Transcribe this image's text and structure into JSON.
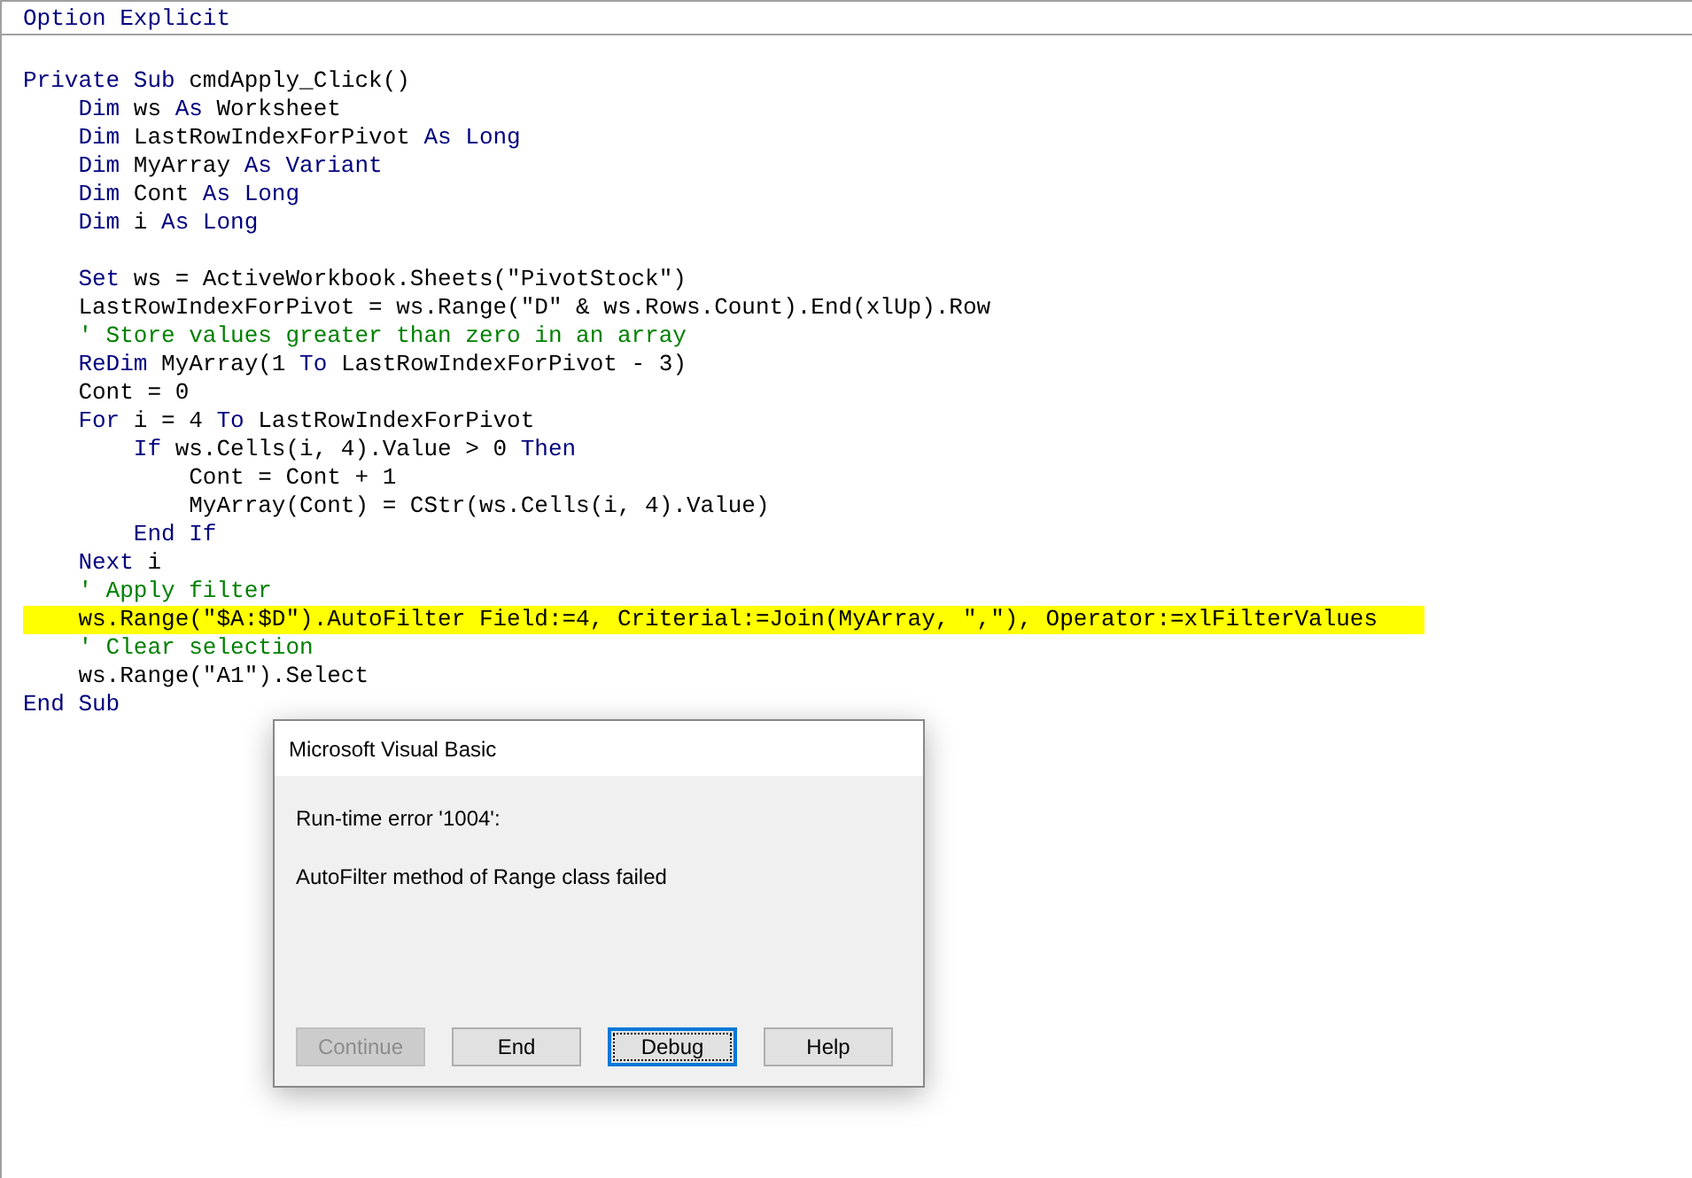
{
  "editor": {
    "declarations": [
      {
        "tokens": [
          {
            "kind": "keyword",
            "text": "Option Explicit"
          }
        ]
      }
    ],
    "lines": [
      {
        "highlighted": false
      },
      {
        "highlighted": false,
        "tokens": [
          {
            "kind": "keyword",
            "text": "Private Sub"
          },
          {
            "kind": "plain",
            "text": " cmdApply_Click()"
          }
        ]
      },
      {
        "highlighted": false,
        "tokens": [
          {
            "kind": "keyword",
            "text": "    Dim"
          },
          {
            "kind": "plain",
            "text": " ws "
          },
          {
            "kind": "keyword",
            "text": "As"
          },
          {
            "kind": "plain",
            "text": " Worksheet"
          }
        ]
      },
      {
        "highlighted": false,
        "tokens": [
          {
            "kind": "keyword",
            "text": "    Dim"
          },
          {
            "kind": "plain",
            "text": " LastRowIndexForPivot "
          },
          {
            "kind": "keyword",
            "text": "As Long"
          }
        ]
      },
      {
        "highlighted": false,
        "tokens": [
          {
            "kind": "keyword",
            "text": "    Dim"
          },
          {
            "kind": "plain",
            "text": " MyArray "
          },
          {
            "kind": "keyword",
            "text": "As Variant"
          }
        ]
      },
      {
        "highlighted": false,
        "tokens": [
          {
            "kind": "keyword",
            "text": "    Dim"
          },
          {
            "kind": "plain",
            "text": " Cont "
          },
          {
            "kind": "keyword",
            "text": "As Long"
          }
        ]
      },
      {
        "highlighted": false,
        "tokens": [
          {
            "kind": "keyword",
            "text": "    Dim"
          },
          {
            "kind": "plain",
            "text": " i "
          },
          {
            "kind": "keyword",
            "text": "As Long"
          }
        ]
      },
      {
        "highlighted": false
      },
      {
        "highlighted": false,
        "tokens": [
          {
            "kind": "keyword",
            "text": "    Set"
          },
          {
            "kind": "plain",
            "text": " ws = ActiveWorkbook.Sheets(\"PivotStock\")"
          }
        ]
      },
      {
        "highlighted": false,
        "tokens": [
          {
            "kind": "plain",
            "text": "    LastRowIndexForPivot = ws.Range(\"D\" & ws.Rows.Count).End(xlUp).Row"
          }
        ]
      },
      {
        "highlighted": false,
        "tokens": [
          {
            "kind": "comment",
            "text": "    ' Store values greater than zero in an array"
          }
        ]
      },
      {
        "highlighted": false,
        "tokens": [
          {
            "kind": "keyword",
            "text": "    ReDim"
          },
          {
            "kind": "plain",
            "text": " MyArray(1 "
          },
          {
            "kind": "keyword",
            "text": "To"
          },
          {
            "kind": "plain",
            "text": " LastRowIndexForPivot - 3)"
          }
        ]
      },
      {
        "highlighted": false,
        "tokens": [
          {
            "kind": "plain",
            "text": "    Cont = 0"
          }
        ]
      },
      {
        "highlighted": false,
        "tokens": [
          {
            "kind": "keyword",
            "text": "    For"
          },
          {
            "kind": "plain",
            "text": " i = 4 "
          },
          {
            "kind": "keyword",
            "text": "To"
          },
          {
            "kind": "plain",
            "text": " LastRowIndexForPivot"
          }
        ]
      },
      {
        "highlighted": false,
        "tokens": [
          {
            "kind": "keyword",
            "text": "        If"
          },
          {
            "kind": "plain",
            "text": " ws.Cells(i, 4).Value > 0 "
          },
          {
            "kind": "keyword",
            "text": "Then"
          }
        ]
      },
      {
        "highlighted": false,
        "tokens": [
          {
            "kind": "plain",
            "text": "            Cont = Cont + 1"
          }
        ]
      },
      {
        "highlighted": false,
        "tokens": [
          {
            "kind": "plain",
            "text": "            MyArray(Cont) = CStr(ws.Cells(i, 4).Value)"
          }
        ]
      },
      {
        "highlighted": false,
        "tokens": [
          {
            "kind": "keyword",
            "text": "        End If"
          }
        ]
      },
      {
        "highlighted": false,
        "tokens": [
          {
            "kind": "keyword",
            "text": "    Next"
          },
          {
            "kind": "plain",
            "text": " i"
          }
        ]
      },
      {
        "highlighted": false,
        "tokens": [
          {
            "kind": "comment",
            "text": "    ' Apply filter"
          }
        ]
      },
      {
        "highlighted": true,
        "tokens": [
          {
            "kind": "plain",
            "text": "    ws.Range(\"$A:$D\").AutoFilter Field:=4, Criterial:=Join(MyArray, \",\"), Operator:=xlFilterValues"
          }
        ]
      },
      {
        "highlighted": false,
        "tokens": [
          {
            "kind": "comment",
            "text": "    ' Clear selection"
          }
        ]
      },
      {
        "highlighted": false,
        "tokens": [
          {
            "kind": "plain",
            "text": "    ws.Range(\"A1\").Select"
          }
        ]
      },
      {
        "highlighted": false,
        "tokens": [
          {
            "kind": "keyword",
            "text": "End Sub"
          }
        ]
      }
    ]
  },
  "dialog": {
    "title": "Microsoft Visual Basic",
    "error": "Run-time error '1004':",
    "message": "AutoFilter method of Range class failed",
    "buttons": [
      {
        "label": "Continue",
        "disabled": true,
        "focused": false
      },
      {
        "label": "End",
        "disabled": false,
        "focused": false
      },
      {
        "label": "Debug",
        "disabled": false,
        "focused": true
      },
      {
        "label": "Help",
        "disabled": false,
        "focused": false
      }
    ]
  }
}
